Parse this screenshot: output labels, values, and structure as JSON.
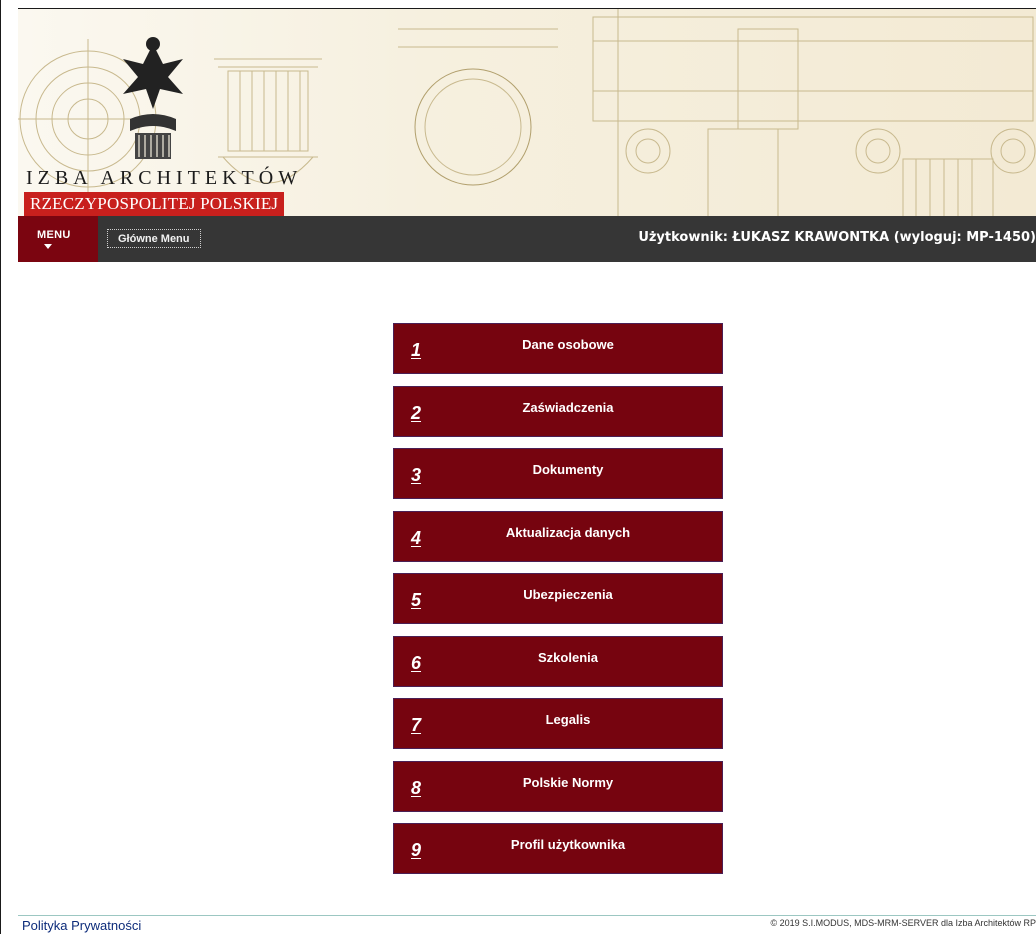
{
  "header": {
    "logo_line1": "IZBA ARCHITEKTÓW",
    "logo_line2": "RZECZYPOSPOLITEJ POLSKIEJ"
  },
  "navbar": {
    "menu_label": "MENU",
    "main_menu_label": "Główne Menu",
    "user_info": "Użytkownik: ŁUKASZ KRAWONTKA (wyloguj: MP-1450)"
  },
  "menu": {
    "items": [
      {
        "number": "1",
        "label": "Dane osobowe"
      },
      {
        "number": "2",
        "label": "Zaświadczenia"
      },
      {
        "number": "3",
        "label": "Dokumenty"
      },
      {
        "number": "4",
        "label": "Aktualizacja danych"
      },
      {
        "number": "5",
        "label": "Ubezpieczenia"
      },
      {
        "number": "6",
        "label": "Szkolenia"
      },
      {
        "number": "7",
        "label": "Legalis"
      },
      {
        "number": "8",
        "label": "Polskie Normy"
      },
      {
        "number": "9",
        "label": "Profil użytkownika"
      }
    ]
  },
  "footer": {
    "privacy": "Polityka Prywatności",
    "copyright": "© 2019 S.I.MODUS, MDS-MRM-SERVER dla Izba Architektów RP"
  },
  "colors": {
    "accent": "#76040f",
    "navbar": "#363636",
    "logo_red": "#c8201d"
  },
  "icons": [
    "eagle-emblem-icon",
    "column-drawing-icon",
    "chevron-down-icon"
  ]
}
